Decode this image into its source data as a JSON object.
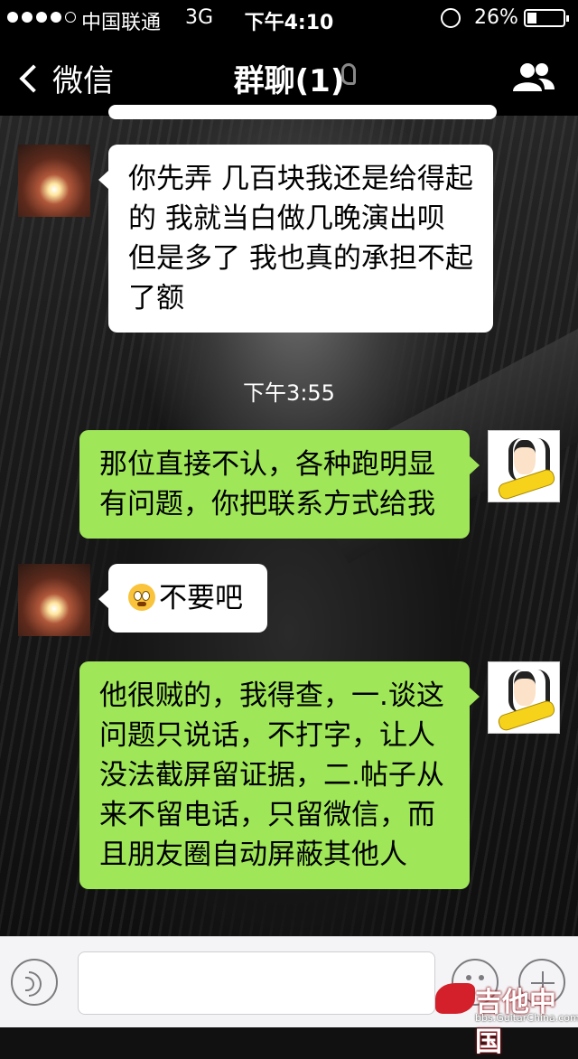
{
  "status_bar": {
    "carrier": "中国联通",
    "network": "3G",
    "time": "下午4:10",
    "battery_percent": "26%",
    "battery_level": 0.26,
    "signal_bars_filled": 4,
    "signal_bars_total": 5
  },
  "nav": {
    "back_label": "微信",
    "title": "群聊(1)"
  },
  "messages": [
    {
      "side": "left",
      "text": "你先弄  几百块我还是给得起的  我就当白做几晚演出呗  但是多了 我也真的承担不起了额"
    },
    {
      "side": "timestamp",
      "text": "下午3:55"
    },
    {
      "side": "right",
      "text": "那位直接不认，各种跑明显有问题，你把联系方式给我"
    },
    {
      "side": "left",
      "text": "不要吧",
      "emoji": "flushed-face-emoji"
    },
    {
      "side": "right",
      "text": "他很贼的，我得查，一.谈这问题只说话，不打字，让人没法截屏留证据，二.帖子从来不留电话，只留微信，而且朋友圈自动屏蔽其他人"
    }
  ],
  "input_bar": {
    "voice_icon": "voice-icon",
    "emoji_icon": "emoji-icon",
    "plus_icon": "plus-icon"
  },
  "watermark": {
    "text": "吉他中国",
    "url": "bbs.GuitarChina.com"
  },
  "colors": {
    "bar_bg": "#000000",
    "bubble_self": "#9fe658",
    "bubble_other": "#ffffff",
    "input_bg": "#f4f4f6"
  }
}
